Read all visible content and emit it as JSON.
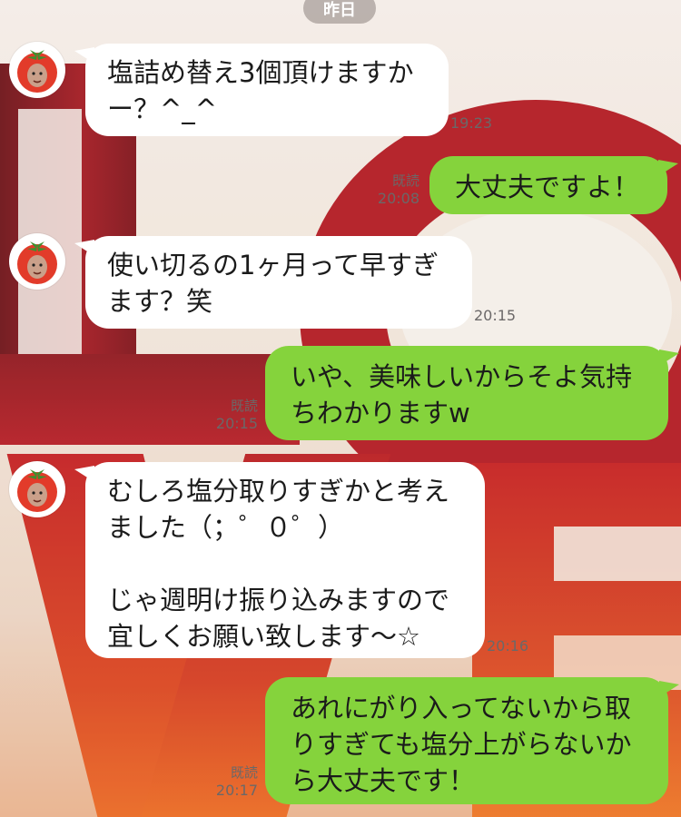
{
  "date_label": "昨日",
  "messages": [
    {
      "from": "other",
      "text": "塩詰め替え3個頂けますか\nー？^_^",
      "time": "19:23"
    },
    {
      "from": "me",
      "text": "大丈夫ですよ！",
      "read": "既読",
      "time": "20:08"
    },
    {
      "from": "other",
      "text": "使い切るの1ヶ月って早すぎ\nます？笑",
      "time": "20:15"
    },
    {
      "from": "me",
      "text": "いや、美味しいからそよ気持\nちわかりますw",
      "read": "既読",
      "time": "20:15"
    },
    {
      "from": "other",
      "text": "むしろ塩分取りすぎかと考え\nました（；゜０゜）\n\nじゃ週明け振り込みますので\n宜しくお願い致します〜☆",
      "time": "20:16"
    },
    {
      "from": "me",
      "text": "あれにがり入ってないから取\nりすぎても塩分上がらないか\nら大丈夫です！",
      "read": "既読",
      "time": "20:17"
    }
  ]
}
